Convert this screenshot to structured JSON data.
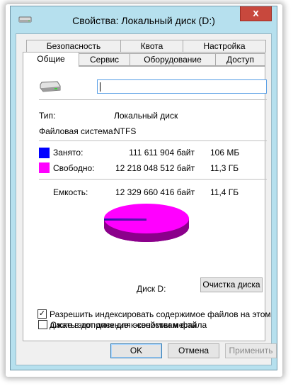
{
  "window": {
    "title": "Свойства: Локальный диск (D:)",
    "close_glyph": "x"
  },
  "tabs": {
    "row1": [
      "Безопасность",
      "Квота",
      "Настройка"
    ],
    "row2": [
      "Общие",
      "Сервис",
      "Оборудование",
      "Доступ"
    ],
    "active": "Общие"
  },
  "general": {
    "name_value": "",
    "type_label": "Тип:",
    "type_value": "Локальный диск",
    "fs_label": "Файловая система:",
    "fs_value": "NTFS",
    "used": {
      "label": "Занято:",
      "bytes": "111 611 904 байт",
      "size": "106 МБ",
      "color": "#0000ff"
    },
    "free": {
      "label": "Свободно:",
      "bytes": "12 218 048 512 байт",
      "size": "11,3 ГБ",
      "color": "#ff00ff"
    },
    "capacity": {
      "label": "Емкость:",
      "bytes": "12 329 660 416 байт",
      "size": "11,4 ГБ"
    },
    "used_fraction": 0.009,
    "disk_label": "Диск D:",
    "cleanup_button": "Очистка диска",
    "compress_label": "Сжать этот диск для экономии места",
    "compress_checked": false,
    "index_label_line1": "Разрешить индексировать содержимое файлов на этом",
    "index_label_line2": "диске в дополнение к свойствам файла",
    "index_checked": true,
    "check_glyph": "✓"
  },
  "buttons": {
    "ok": "OK",
    "cancel": "Отмена",
    "apply": "Применить"
  }
}
